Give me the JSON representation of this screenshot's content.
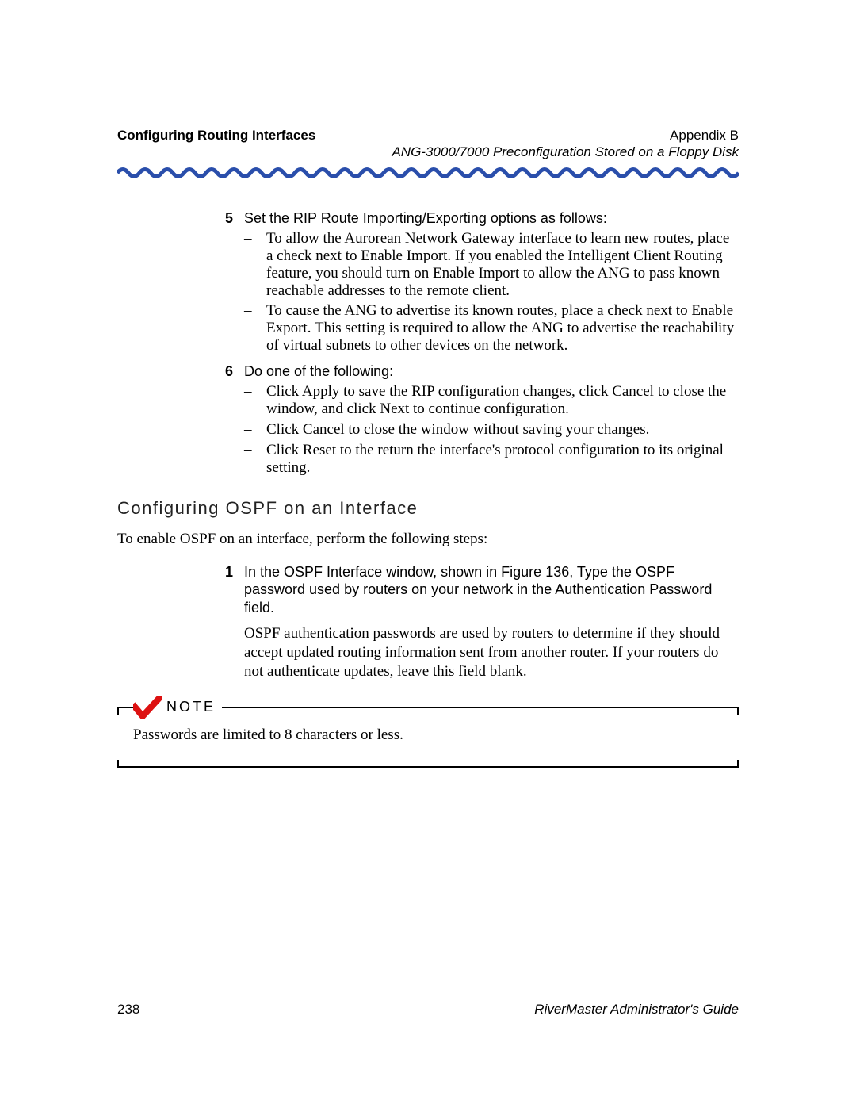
{
  "header": {
    "left": "Configuring Routing Interfaces",
    "right_line1": "Appendix B",
    "right_line2": "ANG-3000/7000 Preconfiguration Stored on a Floppy Disk"
  },
  "steps": {
    "s5": {
      "num": "5",
      "lead": "Set the RIP Route Importing/Exporting options as follows:",
      "bullets": [
        "To allow the Aurorean Network Gateway interface to learn new routes, place a check next to Enable Import. If you enabled the Intelligent Client Routing feature, you should turn on Enable Import to allow the ANG to pass known reachable addresses to the remote client.",
        "To cause the ANG to advertise its known routes, place a check next to Enable Export. This setting is required to allow the ANG to advertise the reachability of virtual subnets to other devices on the network."
      ]
    },
    "s6": {
      "num": "6",
      "lead": "Do one of the following:",
      "bullets": [
        "Click Apply to save the RIP configuration changes, click Cancel to close the window, and click Next to continue configuration.",
        "Click Cancel to close the window without saving your changes.",
        "Click Reset to the return the interface's protocol configuration to its original setting."
      ]
    }
  },
  "section": {
    "title": "Configuring OSPF on an Interface",
    "intro": "To enable OSPF on an interface, perform the following steps:",
    "s1": {
      "num": "1",
      "lead": "In the OSPF Interface window, shown in Figure 136, Type the OSPF password used by routers on your network in the Authentication Password field.",
      "para": "OSPF authentication passwords are used by routers to determine if they should accept updated routing information sent from another router. If your routers do not authenticate updates, leave this field blank."
    }
  },
  "note": {
    "label": "NOTE",
    "text": "Passwords are limited to 8 characters or less."
  },
  "footer": {
    "page": "238",
    "guide": "RiverMaster Administrator's Guide"
  }
}
